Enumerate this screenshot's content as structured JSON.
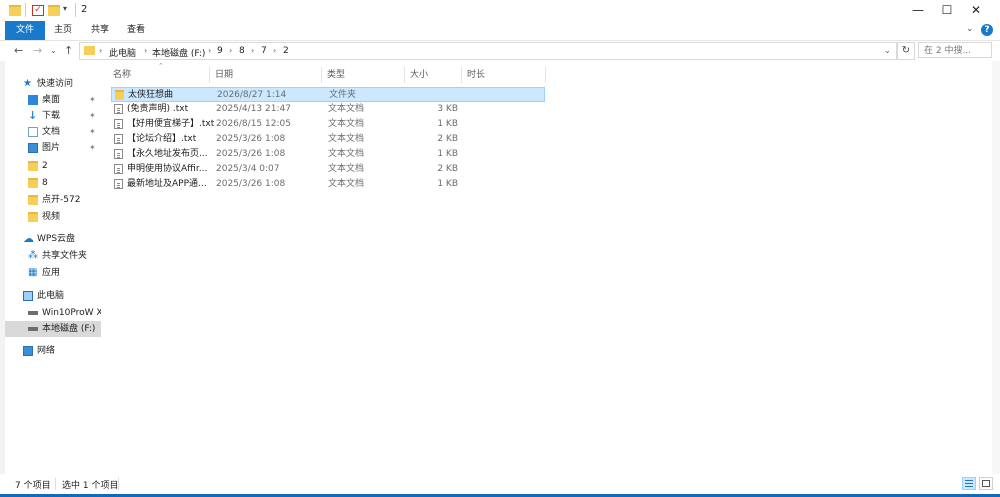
{
  "window": {
    "title": "2",
    "minimize_glyph": "—",
    "maximize_glyph": "☐",
    "close_glyph": "✕",
    "accent": "#1979ca"
  },
  "ribbon": {
    "tabs": [
      "文件",
      "主页",
      "共享",
      "查看"
    ],
    "help_glyph": "?"
  },
  "address": {
    "crumbs": [
      "此电脑",
      "本地磁盘 (F:)",
      "9",
      "8",
      "7",
      "2"
    ],
    "refresh_glyph": "↻",
    "search_placeholder": "在 2 中搜..."
  },
  "nav": {
    "items": [
      {
        "label": "快速访问",
        "icon": "star-icon"
      },
      {
        "label": "桌面",
        "icon": "desktop-icon"
      },
      {
        "label": "下载",
        "icon": "download-icon"
      },
      {
        "label": "文档",
        "icon": "document-icon"
      },
      {
        "label": "图片",
        "icon": "picture-icon"
      },
      {
        "label": "2",
        "icon": "folder-icon"
      },
      {
        "label": "8",
        "icon": "folder-icon"
      },
      {
        "label": "点开-572",
        "icon": "folder-icon"
      },
      {
        "label": "视频",
        "icon": "folder-icon"
      },
      {
        "label": "WPS云盘",
        "icon": "cloud-icon"
      },
      {
        "label": "共享文件夹",
        "icon": "share-icon"
      },
      {
        "label": "应用",
        "icon": "apps-icon"
      },
      {
        "label": "此电脑",
        "icon": "computer-icon"
      },
      {
        "label": "Win10ProW X",
        "icon": "drive-icon"
      },
      {
        "label": "本地磁盘 (F:)",
        "icon": "drive-icon"
      },
      {
        "label": "网络",
        "icon": "network-icon"
      }
    ],
    "pin_glyph": "📌"
  },
  "columns": [
    "名称",
    "日期",
    "类型",
    "大小",
    "时长"
  ],
  "files": [
    {
      "name": "太侠狂想曲",
      "date": "2026/8/27 1:14",
      "type": "文件夹",
      "size": ""
    },
    {
      "name": "(免责声明) .txt",
      "date": "2025/4/13 21:47",
      "type": "文本文档",
      "size": "3 KB"
    },
    {
      "name": "【好用便宜梯子】.txt",
      "date": "2026/8/15 12:05",
      "type": "文本文档",
      "size": "1 KB"
    },
    {
      "name": "【论坛介绍】.txt",
      "date": "2025/3/26 1:08",
      "type": "文本文档",
      "size": "2 KB"
    },
    {
      "name": "【永久地址发布页...",
      "date": "2025/3/26 1:08",
      "type": "文本文档",
      "size": "1 KB"
    },
    {
      "name": "申明使用协议Affir...",
      "date": "2025/3/4 0:07",
      "type": "文本文档",
      "size": "2 KB"
    },
    {
      "name": "最新地址及APP通...",
      "date": "2025/3/26 1:08",
      "type": "文本文档",
      "size": "1 KB"
    }
  ],
  "status": {
    "count": "7 个项目",
    "selected": "选中 1 个项目"
  }
}
